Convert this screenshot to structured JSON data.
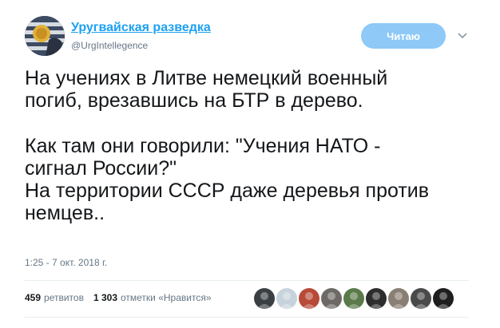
{
  "account": {
    "display_name": "Уругвайская разведка",
    "handle": "@UrgIntellegence"
  },
  "follow_button": {
    "label": "Читаю"
  },
  "tweet": {
    "paragraphs": [
      [
        "На учениях в Литве немецкий военный",
        "погиб, врезавшись на БТР в дерево."
      ],
      [
        "Как там они говорили: \"Учения НАТО -",
        "сигнал России?\"",
        "На территории СССР даже деревья против",
        "немцев.."
      ]
    ],
    "timestamp": "1:25 - 7 окт. 2018 г."
  },
  "stats": {
    "retweets_count": "459",
    "retweets_label": "ретвитов",
    "likes_count": "1 303",
    "likes_label": "отметки «Нравится»"
  },
  "likers": [
    {
      "icon": "avatar-dark-icon",
      "color": "#3a3f44"
    },
    {
      "icon": "avatar-default-icon",
      "color": "#c7d3dc"
    },
    {
      "icon": "avatar-red-icon",
      "color": "#b84a3a"
    },
    {
      "icon": "avatar-man-icon",
      "color": "#6d6a66"
    },
    {
      "icon": "avatar-landscape-icon",
      "color": "#5a7a4a"
    },
    {
      "icon": "avatar-dark-icon",
      "color": "#2d2d2d"
    },
    {
      "icon": "avatar-group-icon",
      "color": "#8a7f74"
    },
    {
      "icon": "avatar-bw-icon",
      "color": "#4a4a4a"
    },
    {
      "icon": "avatar-dark-icon",
      "color": "#1e1e1e"
    }
  ],
  "colors": {
    "link": "#1da1f2",
    "follow_button": "#8ec9f7",
    "muted": "#657786"
  }
}
